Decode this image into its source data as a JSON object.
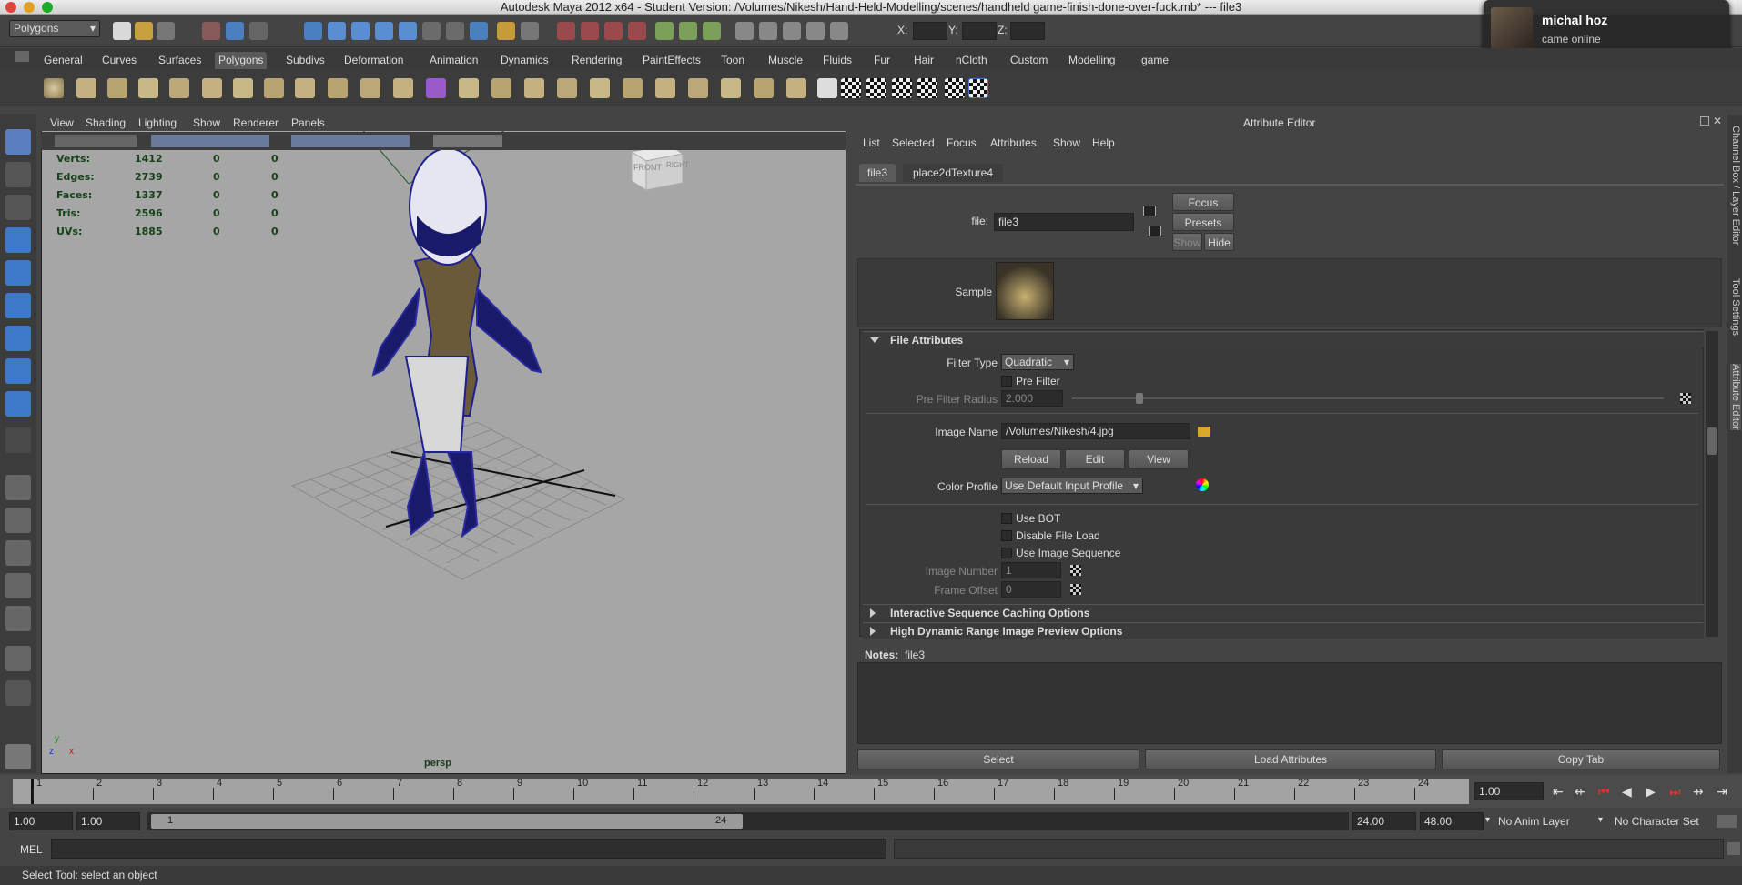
{
  "window": {
    "title": "Autodesk Maya 2012 x64 - Student Version: /Volumes/Nikesh/Hand-Held-Modelling/scenes/handheld game-finish-done-over-fuck.mb*   ---   file3"
  },
  "top": {
    "mode": "Polygons",
    "x_label": "X:",
    "y_label": "Y:",
    "z_label": "Z:"
  },
  "shelf_tabs": [
    "General",
    "Curves",
    "Surfaces",
    "Polygons",
    "Subdivs",
    "Deformation",
    "Animation",
    "Dynamics",
    "Rendering",
    "PaintEffects",
    "Toon",
    "Muscle",
    "Fluids",
    "Fur",
    "Hair",
    "nCloth",
    "Custom",
    "Modelling",
    "game"
  ],
  "viewport": {
    "menu": [
      "View",
      "Shading",
      "Lighting",
      "Show",
      "Renderer",
      "Panels"
    ],
    "hud": [
      {
        "label": "Verts:",
        "v1": "1412",
        "v2": "0",
        "v3": "0"
      },
      {
        "label": "Edges:",
        "v1": "2739",
        "v2": "0",
        "v3": "0"
      },
      {
        "label": "Faces:",
        "v1": "1337",
        "v2": "0",
        "v3": "0"
      },
      {
        "label": "Tris:",
        "v1": "2596",
        "v2": "0",
        "v3": "0"
      },
      {
        "label": "UVs:",
        "v1": "1885",
        "v2": "0",
        "v3": "0"
      }
    ],
    "camera": "persp",
    "viewcube_front": "FRONT",
    "viewcube_right": "RIGHT",
    "axis_x": "x",
    "axis_y": "y",
    "axis_z": "z"
  },
  "attr": {
    "title": "Attribute Editor",
    "menu": [
      "List",
      "Selected",
      "Focus",
      "Attributes",
      "Show",
      "Help"
    ],
    "tabs": [
      "file3",
      "place2dTexture4"
    ],
    "file_label": "file:",
    "file_value": "file3",
    "focus": "Focus",
    "presets": "Presets",
    "show": "Show",
    "hide": "Hide",
    "sample": "Sample",
    "section_file": "File Attributes",
    "filter_type_label": "Filter Type",
    "filter_type": "Quadratic",
    "pre_filter": "Pre Filter",
    "pre_filter_radius_label": "Pre Filter Radius",
    "pre_filter_radius": "2.000",
    "image_name_label": "Image Name",
    "image_name": "/Volumes/Nikesh/4.jpg",
    "reload": "Reload",
    "edit": "Edit",
    "view": "View",
    "color_profile_label": "Color Profile",
    "color_profile": "Use Default Input Profile",
    "use_bot": "Use BOT",
    "disable_file_load": "Disable File Load",
    "use_image_sequence": "Use Image Sequence",
    "image_number_label": "Image Number",
    "image_number": "1",
    "frame_offset_label": "Frame Offset",
    "frame_offset": "0",
    "section_interactive": "Interactive Sequence Caching Options",
    "section_hdr": "High Dynamic Range Image Preview Options",
    "notes_label": "Notes:",
    "notes_value": "file3",
    "select": "Select",
    "load_attributes": "Load Attributes",
    "copy_tab": "Copy Tab"
  },
  "side_tabs": [
    "Channel Box / Layer Editor",
    "Tool Settings",
    "Attribute Editor"
  ],
  "timeline": {
    "ticks": [
      "1",
      "2",
      "3",
      "4",
      "5",
      "6",
      "7",
      "8",
      "9",
      "10",
      "11",
      "12",
      "13",
      "14",
      "15",
      "16",
      "17",
      "18",
      "19",
      "20",
      "21",
      "22",
      "23",
      "24"
    ],
    "current": "1.00"
  },
  "range": {
    "start": "1.00",
    "play_start": "1.00",
    "slider_start": "1",
    "slider_end": "24",
    "play_end": "24.00",
    "end": "48.00",
    "anim_layer": "No Anim Layer",
    "char_set": "No Character Set"
  },
  "mel": {
    "label": "MEL"
  },
  "status": "Select Tool: select an object",
  "notification": {
    "name": "michal hoz",
    "message": "came online"
  },
  "colors": {
    "accent": "#5c8fd6",
    "wire": "#1f1f8f",
    "bg": "#444444"
  }
}
